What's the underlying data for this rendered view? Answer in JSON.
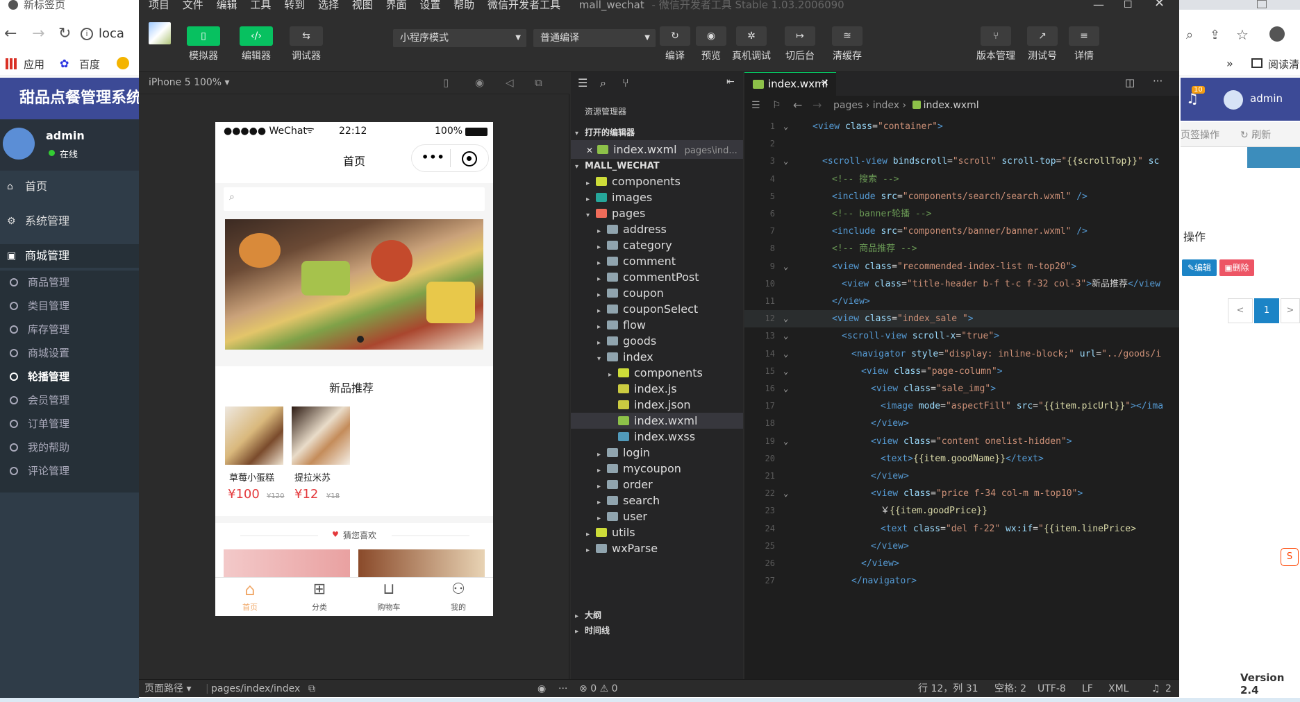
{
  "browser": {
    "tab_title": "新标签页",
    "address_partial": "loca",
    "bookmarks": [
      "应用",
      "百度"
    ],
    "reading_list": "阅读清",
    "admin_brand": "甜品点餐管理系统",
    "user_name": "admin",
    "user_status": "在线",
    "menu": [
      {
        "label": "首页",
        "icon": "home-icon"
      },
      {
        "label": "系统管理",
        "icon": "gear-icon"
      },
      {
        "label": "商城管理",
        "icon": "bag-icon"
      }
    ],
    "submenu": [
      "商品管理",
      "类目管理",
      "库存管理",
      "商城设置",
      "轮播管理",
      "会员管理",
      "订单管理",
      "我的帮助",
      "评论管理"
    ],
    "active_submenu_index": 4,
    "notification_count": "10",
    "admin_name": "admin",
    "tab_ops": "页签操作",
    "refresh": "刷新",
    "action_header": "操作",
    "edit_btn": "编辑",
    "delete_btn": "删除",
    "page_prev": "<",
    "page_current": "1",
    "page_next": ">",
    "version": "Version 2.4"
  },
  "ide": {
    "title": "mall_wechat",
    "title_sub": "- 微信开发者工具 Stable 1.03.2006090",
    "menu": [
      "项目",
      "文件",
      "编辑",
      "工具",
      "转到",
      "选择",
      "视图",
      "界面",
      "设置",
      "帮助",
      "微信开发者工具"
    ],
    "toolbar": {
      "simulator": "模拟器",
      "editor": "编辑器",
      "debugger": "调试器",
      "mode": "小程序模式",
      "compile_mode": "普通编译",
      "compile": "编译",
      "preview": "预览",
      "remote_debug": "真机调试",
      "background": "切后台",
      "clear_cache": "清缓存",
      "version_mgmt": "版本管理",
      "test_id": "测试号",
      "details": "详情"
    },
    "device": "iPhone 5 100%",
    "status": {
      "page_path_label": "页面路径",
      "page_path": "pages/index/index",
      "errors": "0",
      "warnings": "0",
      "position": "行 12，列 31",
      "spaces": "空格: 2",
      "encoding": "UTF-8",
      "eol": "LF",
      "language": "XML",
      "notifications": "2"
    }
  },
  "phone": {
    "carrier": "●●●●● WeChat",
    "time": "22:12",
    "battery": "100%",
    "nav_title": "首页",
    "section_title": "新品推荐",
    "products": [
      {
        "name": "草莓小蛋糕",
        "price": "¥100",
        "old_price": "¥120"
      },
      {
        "name": "提拉米苏",
        "price": "¥12",
        "old_price": "¥18"
      }
    ],
    "guess_title": "猜您喜欢",
    "tabs": [
      "首页",
      "分类",
      "购物车",
      "我的"
    ]
  },
  "explorer": {
    "header": "资源管理器",
    "open_editors": "打开的编辑器",
    "open_file": "index.wxml",
    "open_file_path": "pages\\ind...",
    "project": "MALL_WECHAT",
    "items": [
      {
        "label": "components",
        "depth": 1,
        "arrow": "▸",
        "type": "folder-special"
      },
      {
        "label": "images",
        "depth": 1,
        "arrow": "▸",
        "type": "folder-img"
      },
      {
        "label": "pages",
        "depth": 1,
        "arrow": "▾",
        "type": "folder-pages"
      },
      {
        "label": "address",
        "depth": 2,
        "arrow": "▸",
        "type": "folder"
      },
      {
        "label": "category",
        "depth": 2,
        "arrow": "▸",
        "type": "folder"
      },
      {
        "label": "comment",
        "depth": 2,
        "arrow": "▸",
        "type": "folder"
      },
      {
        "label": "commentPost",
        "depth": 2,
        "arrow": "▸",
        "type": "folder"
      },
      {
        "label": "coupon",
        "depth": 2,
        "arrow": "▸",
        "type": "folder"
      },
      {
        "label": "couponSelect",
        "depth": 2,
        "arrow": "▸",
        "type": "folder"
      },
      {
        "label": "flow",
        "depth": 2,
        "arrow": "▸",
        "type": "folder"
      },
      {
        "label": "goods",
        "depth": 2,
        "arrow": "▸",
        "type": "folder"
      },
      {
        "label": "index",
        "depth": 2,
        "arrow": "▾",
        "type": "folder"
      },
      {
        "label": "components",
        "depth": 3,
        "arrow": "▸",
        "type": "folder-special"
      },
      {
        "label": "index.js",
        "depth": 3,
        "arrow": "",
        "type": "js"
      },
      {
        "label": "index.json",
        "depth": 3,
        "arrow": "",
        "type": "json"
      },
      {
        "label": "index.wxml",
        "depth": 3,
        "arrow": "",
        "type": "wxml"
      },
      {
        "label": "index.wxss",
        "depth": 3,
        "arrow": "",
        "type": "wxss"
      },
      {
        "label": "login",
        "depth": 2,
        "arrow": "▸",
        "type": "folder"
      },
      {
        "label": "mycoupon",
        "depth": 2,
        "arrow": "▸",
        "type": "folder"
      },
      {
        "label": "order",
        "depth": 2,
        "arrow": "▸",
        "type": "folder"
      },
      {
        "label": "search",
        "depth": 2,
        "arrow": "▸",
        "type": "folder"
      },
      {
        "label": "user",
        "depth": 2,
        "arrow": "▸",
        "type": "folder"
      },
      {
        "label": "utils",
        "depth": 1,
        "arrow": "▸",
        "type": "folder-special"
      },
      {
        "label": "wxParse",
        "depth": 1,
        "arrow": "▸",
        "type": "folder"
      }
    ],
    "outline": "大纲",
    "timeline": "时间线"
  },
  "editor": {
    "tab": "index.wxml",
    "breadcrumb": [
      "pages",
      "index",
      "index.wxml"
    ],
    "lines": [
      {
        "n": "1",
        "fold": "⌄",
        "html": "<span class='t'>&lt;view</span> <span class='a'>class</span><span class='p'>=</span><span class='s'>\"container\"</span><span class='t'>&gt;</span>"
      },
      {
        "n": "2",
        "fold": "",
        "html": ""
      },
      {
        "n": "3",
        "fold": "⌄",
        "html": "<span class='t'>&lt;scroll-view</span> <span class='a'>bindscroll</span><span class='p'>=</span><span class='s'>\"scroll\"</span> <span class='a'>scroll-top</span><span class='p'>=</span><span class='s'>\"</span><span class='y'>{{scrollTop}}</span><span class='s'>\"</span> <span class='a'>sc</span>"
      },
      {
        "n": "4",
        "fold": "",
        "html": "<span class='c'>&lt;!-- 搜索 --&gt;</span>"
      },
      {
        "n": "5",
        "fold": "",
        "html": "<span class='t'>&lt;include</span> <span class='a'>src</span><span class='p'>=</span><span class='s'>\"components/search/search.wxml\"</span> <span class='t'>/&gt;</span>"
      },
      {
        "n": "6",
        "fold": "",
        "html": "<span class='c'>&lt;!-- banner轮播 --&gt;</span>"
      },
      {
        "n": "7",
        "fold": "",
        "html": "<span class='t'>&lt;include</span> <span class='a'>src</span><span class='p'>=</span><span class='s'>\"components/banner/banner.wxml\"</span> <span class='t'>/&gt;</span>"
      },
      {
        "n": "8",
        "fold": "",
        "html": "<span class='c'>&lt;!-- 商品推荐 --&gt;</span>"
      },
      {
        "n": "9",
        "fold": "⌄",
        "html": "<span class='t'>&lt;view</span> <span class='a'>class</span><span class='p'>=</span><span class='s'>\"recommended-index-list m-top20\"</span><span class='t'>&gt;</span>"
      },
      {
        "n": "10",
        "fold": "",
        "html": "<span class='t'>&lt;view</span> <span class='a'>class</span><span class='p'>=</span><span class='s'>\"title-header b-f t-c f-32 col-3\"</span><span class='t'>&gt;</span><span class='p'>新品推荐</span><span class='t'>&lt;/view</span>"
      },
      {
        "n": "11",
        "fold": "",
        "html": "<span class='t'>&lt;/view&gt;</span>"
      },
      {
        "n": "12",
        "fold": "⌄",
        "html": "<span class='t'>&lt;view</span> <span class='a'>class</span><span class='p'>=</span><span class='s'>\"index_sale \"</span><span class='t'>&gt;</span>"
      },
      {
        "n": "13",
        "fold": "⌄",
        "html": "<span class='t'>&lt;scroll-view</span> <span class='a'>scroll-x</span><span class='p'>=</span><span class='s'>\"true\"</span><span class='t'>&gt;</span>"
      },
      {
        "n": "14",
        "fold": "⌄",
        "html": "<span class='t'>&lt;navigator</span> <span class='a'>style</span><span class='p'>=</span><span class='s'>\"display: inline-block;\"</span> <span class='a'>url</span><span class='p'>=</span><span class='s'>\"../goods/i</span>"
      },
      {
        "n": "15",
        "fold": "⌄",
        "html": "<span class='t'>&lt;view</span> <span class='a'>class</span><span class='p'>=</span><span class='s'>\"page-column\"</span><span class='t'>&gt;</span>"
      },
      {
        "n": "16",
        "fold": "⌄",
        "html": "<span class='t'>&lt;view</span> <span class='a'>class</span><span class='p'>=</span><span class='s'>\"sale_img\"</span><span class='t'>&gt;</span>"
      },
      {
        "n": "17",
        "fold": "",
        "html": "<span class='t'>&lt;image</span> <span class='a'>mode</span><span class='p'>=</span><span class='s'>\"aspectFill\"</span> <span class='a'>src</span><span class='p'>=</span><span class='s'>\"</span><span class='y'>{{item.picUrl}}</span><span class='s'>\"</span><span class='t'>&gt;&lt;/ima</span>"
      },
      {
        "n": "18",
        "fold": "",
        "html": "<span class='t'>&lt;/view&gt;</span>"
      },
      {
        "n": "19",
        "fold": "⌄",
        "html": "<span class='t'>&lt;view</span> <span class='a'>class</span><span class='p'>=</span><span class='s'>\"content onelist-hidden\"</span><span class='t'>&gt;</span>"
      },
      {
        "n": "20",
        "fold": "",
        "html": "<span class='t'>&lt;text&gt;</span><span class='y'>{{item.goodName}}</span><span class='t'>&lt;/text&gt;</span>"
      },
      {
        "n": "21",
        "fold": "",
        "html": "<span class='t'>&lt;/view&gt;</span>"
      },
      {
        "n": "22",
        "fold": "⌄",
        "html": "<span class='t'>&lt;view</span> <span class='a'>class</span><span class='p'>=</span><span class='s'>\"price f-34 col-m m-top10\"</span><span class='t'>&gt;</span>"
      },
      {
        "n": "23",
        "fold": "",
        "html": "<span class='p'>￥</span><span class='y'>{{item.goodPrice}}</span>"
      },
      {
        "n": "24",
        "fold": "",
        "html": "<span class='t'>&lt;text</span> <span class='a'>class</span><span class='p'>=</span><span class='s'>\"del f-22\"</span> <span class='a'>wx:if</span><span class='p'>=</span><span class='s'>\"</span><span class='y'>{{item.linePrice&gt;</span>"
      },
      {
        "n": "25",
        "fold": "",
        "html": "<span class='t'>&lt;/view&gt;</span>"
      },
      {
        "n": "26",
        "fold": "",
        "html": "<span class='t'>&lt;/view&gt;</span>"
      },
      {
        "n": "27",
        "fold": "",
        "html": "<span class='t'>&lt;/navigator&gt;</span>"
      }
    ],
    "indents": [
      0,
      0,
      1,
      2,
      2,
      2,
      2,
      2,
      2,
      3,
      2,
      2,
      3,
      4,
      5,
      6,
      7,
      6,
      6,
      7,
      6,
      6,
      7,
      7,
      6,
      5,
      4
    ]
  },
  "colors": {
    "accent_green": "#07c160",
    "admin_blue": "#3c4a96",
    "price_red": "#e4393c"
  }
}
